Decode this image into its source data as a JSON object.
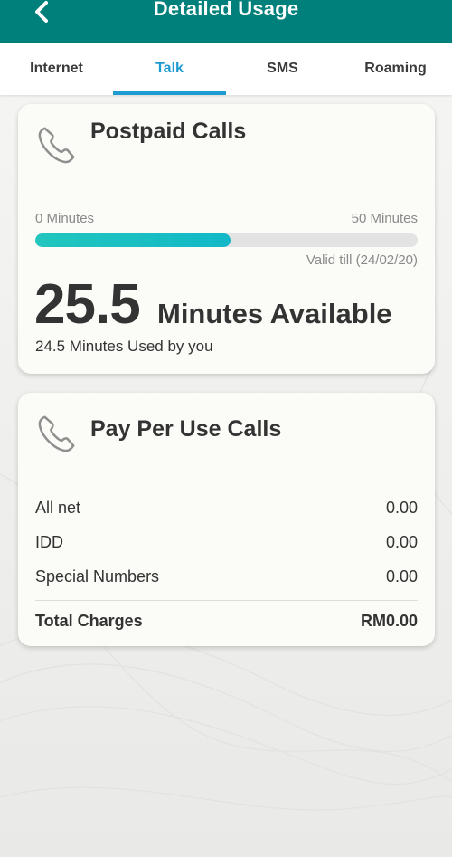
{
  "header": {
    "title": "Detailed Usage",
    "back_icon": "chevron-left-icon"
  },
  "colors": {
    "header_bg": "#00807b",
    "tab_active": "#1e9bd0",
    "progress_fill": "#22c6be"
  },
  "tabs": [
    {
      "label": "Internet",
      "active": false
    },
    {
      "label": "Talk",
      "active": true
    },
    {
      "label": "SMS",
      "active": false
    },
    {
      "label": "Roaming",
      "active": false
    }
  ],
  "postpaid": {
    "icon": "phone-icon",
    "title": "Postpaid Calls",
    "range_min": "0 Minutes",
    "range_max": "50 Minutes",
    "progress_fraction": 0.51,
    "valid_till": "Valid till (24/02/20)",
    "available_value": "25.5",
    "available_label": "Minutes Available",
    "used_text": "24.5 Minutes Used by you"
  },
  "pay_per_use": {
    "icon": "phone-icon",
    "title": "Pay Per Use Calls",
    "rows": [
      {
        "label": "All net",
        "value": "0.00"
      },
      {
        "label": "IDD",
        "value": "0.00"
      },
      {
        "label": "Special Numbers",
        "value": "0.00"
      }
    ],
    "total_label": "Total Charges",
    "total_value": "RM0.00"
  }
}
